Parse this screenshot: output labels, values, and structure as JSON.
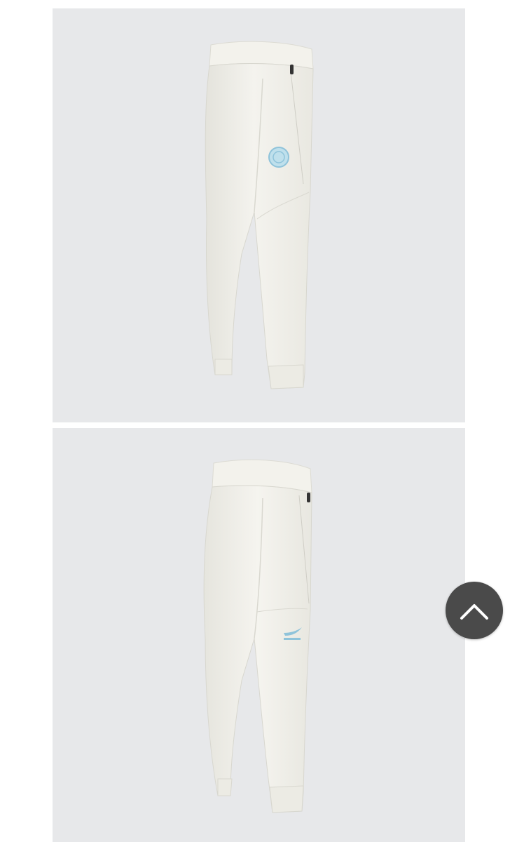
{
  "gallery": {
    "images": [
      {
        "name": "pants-front-view",
        "label": ""
      },
      {
        "name": "pants-back-view",
        "label": ""
      }
    ]
  },
  "scroll_top_button": {
    "icon": "chevron-up-icon",
    "background": "#4a4a4a"
  },
  "colors": {
    "photo_background": "#e7e8ea",
    "garment": "#f2f1ea",
    "logo_accent": "#8fc3da"
  }
}
